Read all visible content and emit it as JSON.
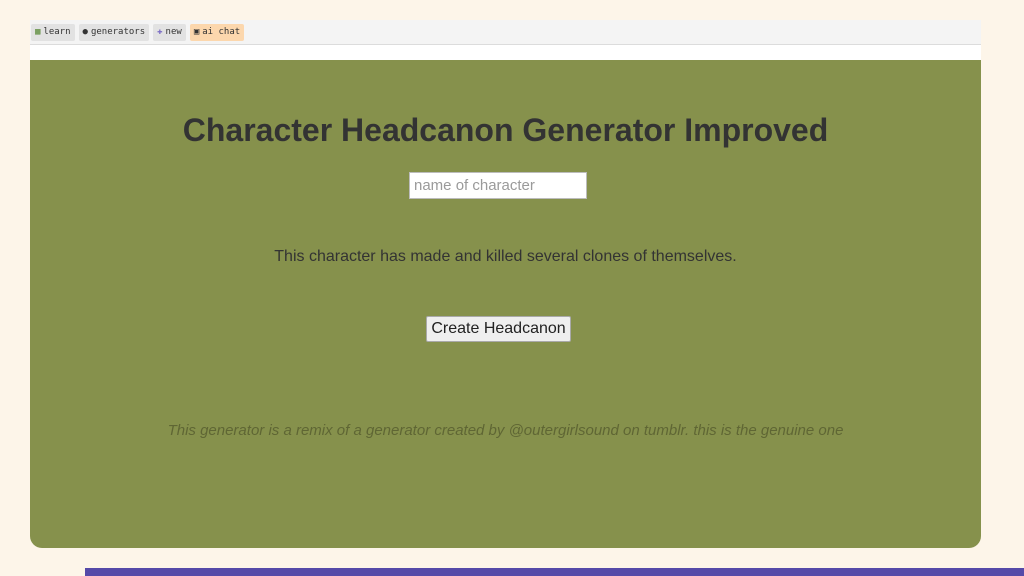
{
  "nav": {
    "items": [
      {
        "label": "learn",
        "icon": "book-icon"
      },
      {
        "label": "generators",
        "icon": "generators-icon"
      },
      {
        "label": "new",
        "icon": "plus-icon"
      },
      {
        "label": "ai chat",
        "icon": "chat-icon"
      }
    ]
  },
  "main": {
    "title": "Character Headcanon Generator Improved",
    "name_input": {
      "placeholder": "name of character",
      "value": ""
    },
    "result_text": "This character has made and killed several clones of themselves.",
    "create_button_label": "Create Headcanon",
    "credit_text": "This generator is a remix of a generator created by @outergirlsound on tumblr. this is the genuine one"
  },
  "colors": {
    "page_background": "#fdf5e9",
    "panel_background": "#86914c",
    "accent_bar": "#5549a8",
    "chat_button": "#fcd7ad",
    "title_text": "#333333"
  }
}
